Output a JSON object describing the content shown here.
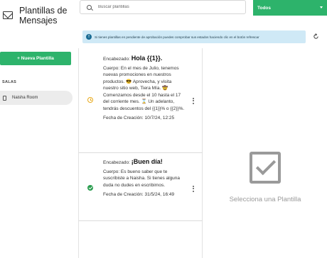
{
  "app": {
    "title": "Plantillas de Mensajes"
  },
  "sidebar": {
    "new_button_label": "+ Nueva Plantilla",
    "rooms_label": "SALAS",
    "rooms": [
      {
        "label": "Naisha Room"
      }
    ]
  },
  "search": {
    "placeholder": "Buscar plantillas",
    "value": ""
  },
  "filter": {
    "selected": "Todos"
  },
  "banner": {
    "text": "Si tienes plantillas en pendiente de aprobación puedes comprobar sus estados haciendo clic en el botón refrescar"
  },
  "templates": [
    {
      "status": "pending",
      "status_icon": "clock-icon",
      "header_label": "Encabezado:",
      "header_value": "Hola {{1}}.",
      "body": "Cuerpo: En el mes de Julio, tenemos nuevas promociones en nuestros productos. 😎 Aprovecha, y visita nuestro sitio web, Tiera Mía. 🤠 Comenzamos desde el 10 hasta el 17 del corriente mes. ⌛ Un adelanto, tendrás descuentos del {{1}}% o {{2}}%.",
      "date": "Fecha de Creación: 10/7/24, 12:25"
    },
    {
      "status": "approved",
      "status_icon": "check-circle-icon",
      "header_label": "Encabezado:",
      "header_value": "¡Buen día!",
      "body": "Cuerpo: Es bueno saber que te suscribiste a Naisha. Si tienes alguna duda no dudes en escribirnos.",
      "date": "Fecha de Creación: 31/5/24, 16:49"
    }
  ],
  "preview": {
    "empty_text": "Selecciona una Plantilla"
  },
  "colors": {
    "accent_green": "#2db36b",
    "banner_bg": "#cfe9f6",
    "pending": "#e8a91a",
    "approved": "#2a9d4f"
  }
}
